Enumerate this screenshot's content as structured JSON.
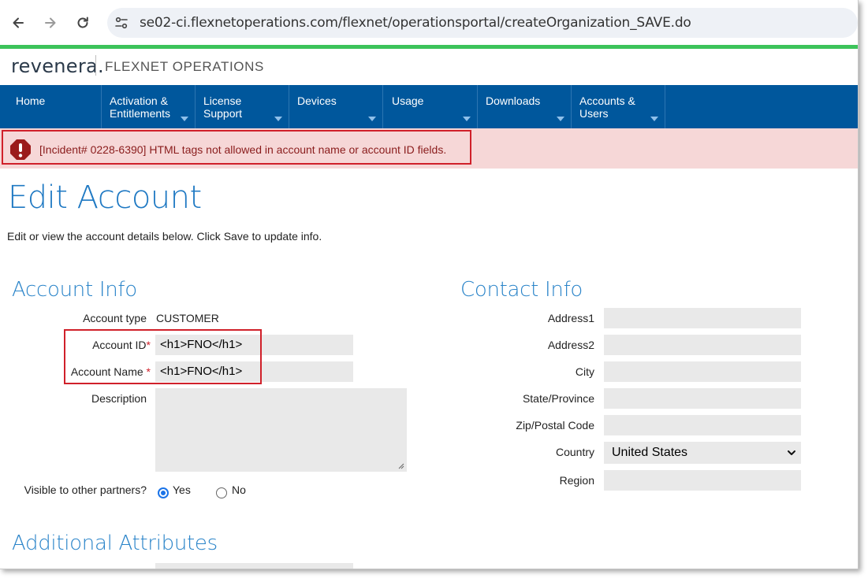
{
  "browser": {
    "url": "se02-ci.flexnetoperations.com/flexnet/operationsportal/createOrganization_SAVE.do"
  },
  "brand": {
    "logo_text": "revenera.",
    "product_name": "FLEXNET OPERATIONS"
  },
  "nav": {
    "items": [
      {
        "label": "Home",
        "has_menu": false
      },
      {
        "label": "Activation & Entitlements",
        "has_menu": true
      },
      {
        "label": "License Support",
        "has_menu": true
      },
      {
        "label": "Devices",
        "has_menu": true
      },
      {
        "label": "Usage",
        "has_menu": true
      },
      {
        "label": "Downloads",
        "has_menu": true
      },
      {
        "label": "Accounts & Users",
        "has_menu": true
      }
    ]
  },
  "alert": {
    "message": "[Incident# 0228-6390] HTML tags not allowed in account name or account ID fields.",
    "color": "#d0202a"
  },
  "page": {
    "title": "Edit Account",
    "intro": "Edit or view the account details below. Click Save to update info."
  },
  "account_info": {
    "title": "Account Info",
    "type_label": "Account type",
    "type_value": "CUSTOMER",
    "id_label": "Account ID",
    "id_value": "<h1>FNO</h1>",
    "name_label": "Account Name",
    "name_value": "<h1>FNO</h1>",
    "required_marker": "*",
    "description_label": "Description",
    "description_value": "",
    "visible_label": "Visible to other partners?",
    "visible_options": [
      {
        "label": "Yes",
        "selected": true
      },
      {
        "label": "No",
        "selected": false
      }
    ]
  },
  "contact_info": {
    "title": "Contact Info",
    "fields": {
      "address1": {
        "label": "Address1",
        "value": ""
      },
      "address2": {
        "label": "Address2",
        "value": ""
      },
      "city": {
        "label": "City",
        "value": ""
      },
      "state": {
        "label": "State/Province",
        "value": ""
      },
      "zip": {
        "label": "Zip/Postal Code",
        "value": ""
      },
      "country": {
        "label": "Country",
        "value": "United States"
      },
      "region": {
        "label": "Region",
        "value": ""
      }
    }
  },
  "additional": {
    "title": "Additional Attributes"
  },
  "colors": {
    "nav_bg": "#00579c",
    "accent_blue": "#1f79c3",
    "alert_bg": "#f6d7d7",
    "progress_green": "#3cc35a"
  }
}
